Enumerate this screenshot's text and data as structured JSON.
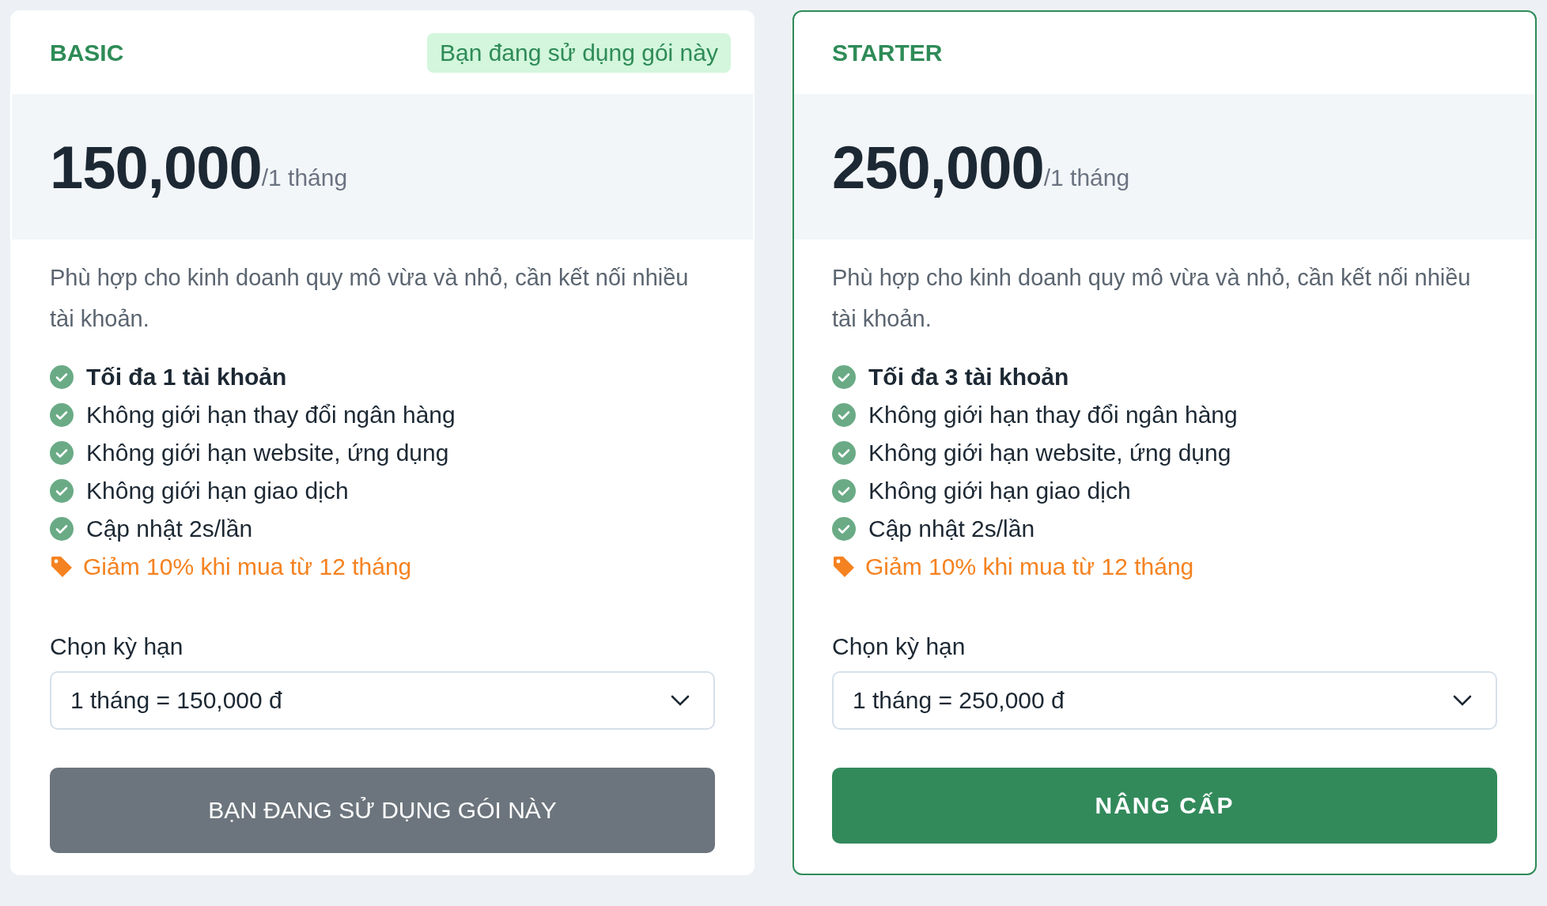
{
  "plans": [
    {
      "name": "BASIC",
      "selected": false,
      "current": true,
      "badge": "Bạn đang sử dụng gói này",
      "price": "150,000",
      "period": "/1 tháng",
      "description": "Phù hợp cho kinh doanh quy mô vừa và nhỏ, cần kết nối nhiều tài khoản.",
      "features": [
        {
          "kind": "highlight",
          "text": "Tối đa 1 tài khoản"
        },
        {
          "kind": "check",
          "text": "Không giới hạn thay đổi ngân hàng"
        },
        {
          "kind": "check",
          "text": "Không giới hạn website, ứng dụng"
        },
        {
          "kind": "check",
          "text": "Không giới hạn giao dịch"
        },
        {
          "kind": "check",
          "text": "Cập nhật 2s/lần"
        },
        {
          "kind": "promo",
          "text": "Giảm 10% khi mua từ 12 tháng"
        }
      ],
      "term_label": "Chọn kỳ hạn",
      "term_value": "1 tháng = 150,000 đ",
      "button": "BẠN ĐANG SỬ DỤNG GÓI NÀY"
    },
    {
      "name": "STARTER",
      "selected": true,
      "current": false,
      "price": "250,000",
      "period": "/1 tháng",
      "description": "Phù hợp cho kinh doanh quy mô vừa và nhỏ, cần kết nối nhiều tài khoản.",
      "features": [
        {
          "kind": "highlight",
          "text": "Tối đa 3 tài khoản"
        },
        {
          "kind": "check",
          "text": "Không giới hạn thay đổi ngân hàng"
        },
        {
          "kind": "check",
          "text": "Không giới hạn website, ứng dụng"
        },
        {
          "kind": "check",
          "text": "Không giới hạn giao dịch"
        },
        {
          "kind": "check",
          "text": "Cập nhật 2s/lần"
        },
        {
          "kind": "promo",
          "text": "Giảm 10% khi mua từ 12 tháng"
        }
      ],
      "term_label": "Chọn kỳ hạn",
      "term_value": "1 tháng = 250,000 đ",
      "button": "NÂNG CẤP"
    }
  ]
}
